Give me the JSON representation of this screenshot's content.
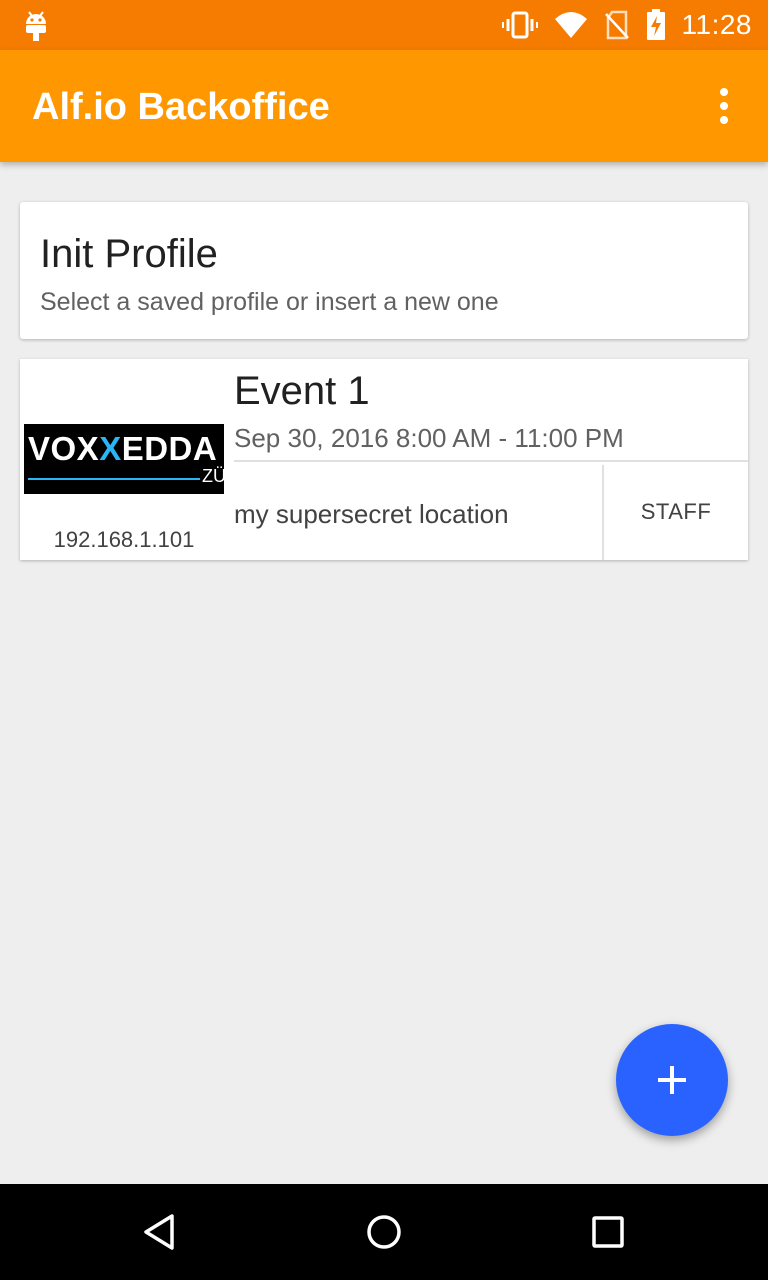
{
  "status_bar": {
    "time": "11:28",
    "icons": [
      "android-icon",
      "vibrate-icon",
      "wifi-icon",
      "no-sim-icon",
      "battery-charging-icon"
    ]
  },
  "app_bar": {
    "title": "Alf.io Backoffice",
    "menu_icon": "overflow-menu-icon"
  },
  "header_card": {
    "title": "Init Profile",
    "subtitle": "Select a saved profile or insert a new one"
  },
  "events": [
    {
      "logo_text_1": "VOX",
      "logo_text_accent": "X",
      "logo_text_2": "EDDA",
      "logo_city": "ZÜ",
      "name": "Event 1",
      "date": "Sep 30, 2016 8:00 AM - 11:00 PM",
      "location": "my supersecret location",
      "role_button": "STAFF",
      "server_ip": "192.168.1.101"
    }
  ],
  "fab": {
    "icon": "add-icon"
  },
  "nav_bar": {
    "icons": [
      "back-icon",
      "home-icon",
      "recents-icon"
    ]
  },
  "colors": {
    "status_bar": "#f57c00",
    "app_bar": "#ff9800",
    "fab": "#2962ff",
    "background": "#eeeeee"
  }
}
